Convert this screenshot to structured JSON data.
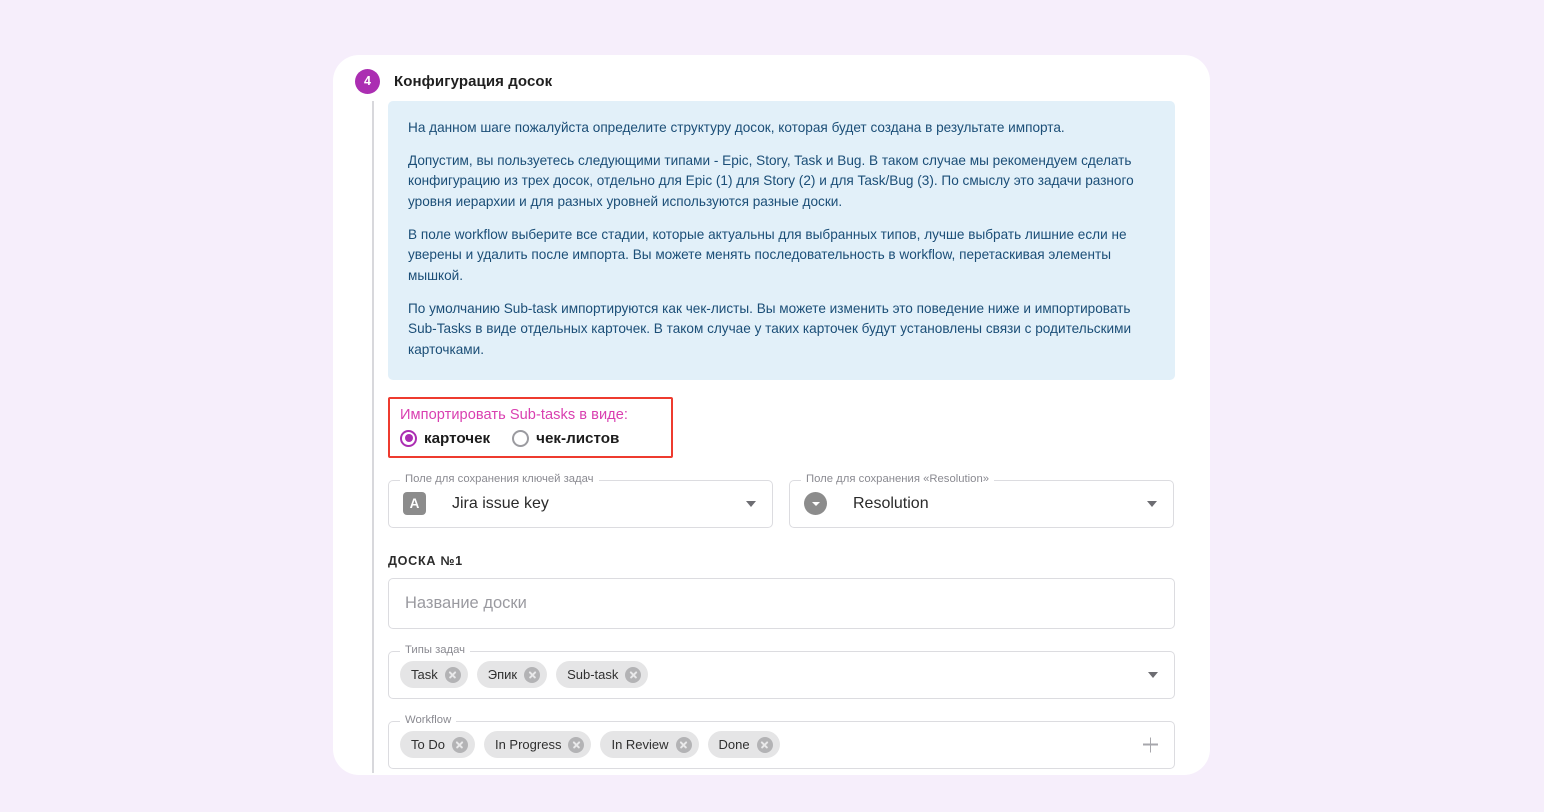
{
  "theme": {
    "page_background": "#f6eefb",
    "card_background": "#ffffff",
    "accent_purple": "#ab2eb2",
    "info_background": "#e2f0f9",
    "info_text": "#1b4e77",
    "highlight_border": "#ee3b2f",
    "highlight_label": "#d93fb0",
    "chip_background": "#e5e5e6"
  },
  "step": {
    "number": "4",
    "title": "Конфигурация досок"
  },
  "info": {
    "paragraphs": [
      "На данном шаге пожалуйста определите структуру досок, которая будет создана в результате импорта.",
      "Допустим, вы пользуетесь следующими типами - Epic, Story, Task и Bug. В таком случае мы рекомендуем сделать конфигурацию из трех досок, отдельно для Epic (1) для Story (2) и для Task/Bug (3). По смыслу это задачи разного уровня иерархии и для разных уровней используются разные доски.",
      "В поле workflow выберите все стадии, которые актуальны для выбранных типов, лучше выбрать лишние если не уверены и удалить после импорта. Вы можете менять последовательность в workflow, перетаскивая элементы мышкой.",
      "По умолчанию Sub-task импортируются как чек-листы. Вы можете изменить это поведение ниже и импортировать Sub-Tasks в виде отдельных карточек. В таком случае у таких карточек будут установлены связи с родительскими карточками."
    ]
  },
  "subtask_mode": {
    "legend": "Импортировать Sub-tasks в виде:",
    "options": [
      {
        "label": "карточек",
        "selected": true
      },
      {
        "label": "чек-листов",
        "selected": false
      }
    ]
  },
  "selects": [
    {
      "legend": "Поле для сохранения ключей задач",
      "icon": "text-field-icon",
      "icon_glyph": "A",
      "value": "Jira issue key"
    },
    {
      "legend": "Поле для сохранения «Resolution»",
      "icon": "select-field-icon",
      "icon_glyph": "",
      "value": "Resolution"
    }
  ],
  "board": {
    "heading": "ДОСКА №1",
    "name_placeholder": "Название доски",
    "task_types": {
      "legend": "Типы задач",
      "chips": [
        "Task",
        "Эпик",
        "Sub-task"
      ]
    },
    "workflow": {
      "legend": "Workflow",
      "chips": [
        "To Do",
        "In Progress",
        "In Review",
        "Done"
      ]
    }
  }
}
